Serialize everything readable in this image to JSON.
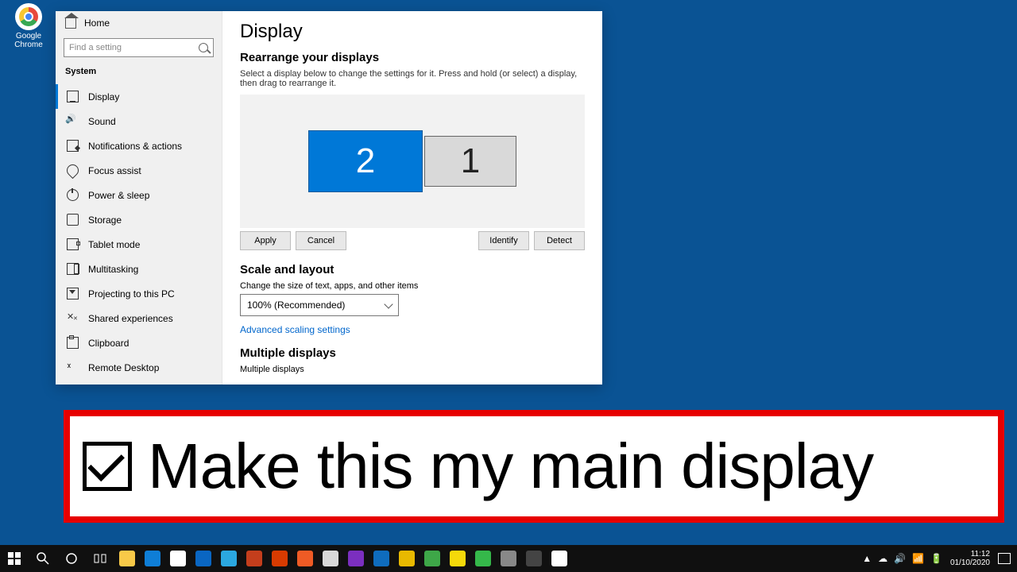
{
  "desktop": {
    "icons": [
      {
        "name": "chrome",
        "label": "Google Chrome"
      }
    ]
  },
  "settings": {
    "home_label": "Home",
    "search_placeholder": "Find a setting",
    "sidebar_title": "System",
    "items": [
      {
        "key": "display",
        "label": "Display",
        "active": true
      },
      {
        "key": "sound",
        "label": "Sound"
      },
      {
        "key": "notifications",
        "label": "Notifications & actions"
      },
      {
        "key": "focus",
        "label": "Focus assist"
      },
      {
        "key": "power",
        "label": "Power & sleep"
      },
      {
        "key": "storage",
        "label": "Storage"
      },
      {
        "key": "tablet",
        "label": "Tablet mode"
      },
      {
        "key": "multitask",
        "label": "Multitasking"
      },
      {
        "key": "projecting",
        "label": "Projecting to this PC"
      },
      {
        "key": "shared",
        "label": "Shared experiences"
      },
      {
        "key": "clipboard",
        "label": "Clipboard"
      },
      {
        "key": "remote",
        "label": "Remote Desktop"
      }
    ],
    "page_title": "Display",
    "rearrange_heading": "Rearrange your displays",
    "rearrange_hint": "Select a display below to change the settings for it. Press and hold (or select) a display, then drag to rearrange it.",
    "monitors": {
      "selected": "2",
      "other": "1"
    },
    "buttons": {
      "apply": "Apply",
      "cancel": "Cancel",
      "identify": "Identify",
      "detect": "Detect"
    },
    "scale_heading": "Scale and layout",
    "scale_label": "Change the size of text, apps, and other items",
    "scale_value": "100% (Recommended)",
    "advanced_link": "Advanced scaling settings",
    "multi_heading": "Multiple displays",
    "multi_label": "Multiple displays"
  },
  "callout": {
    "text": "Make this my main display",
    "checked": true
  },
  "taskbar": {
    "tray_icons": [
      "▲",
      "☁",
      "🔊",
      "📶",
      "🔋"
    ],
    "time": "11:12",
    "date": "01/10/2020",
    "app_colors": [
      "#f8c948",
      "#0f7ed6",
      "#ffffff",
      "#0a66c2",
      "#2ba8e0",
      "#c43e1c",
      "#d83b01",
      "#ef5b25",
      "#d9d9d9",
      "#7b2fbf",
      "#0f6cbd",
      "#e8b900",
      "#3ea748",
      "#f5d90a",
      "#35b84a",
      "#888888",
      "#444444",
      "#ffffff"
    ]
  }
}
